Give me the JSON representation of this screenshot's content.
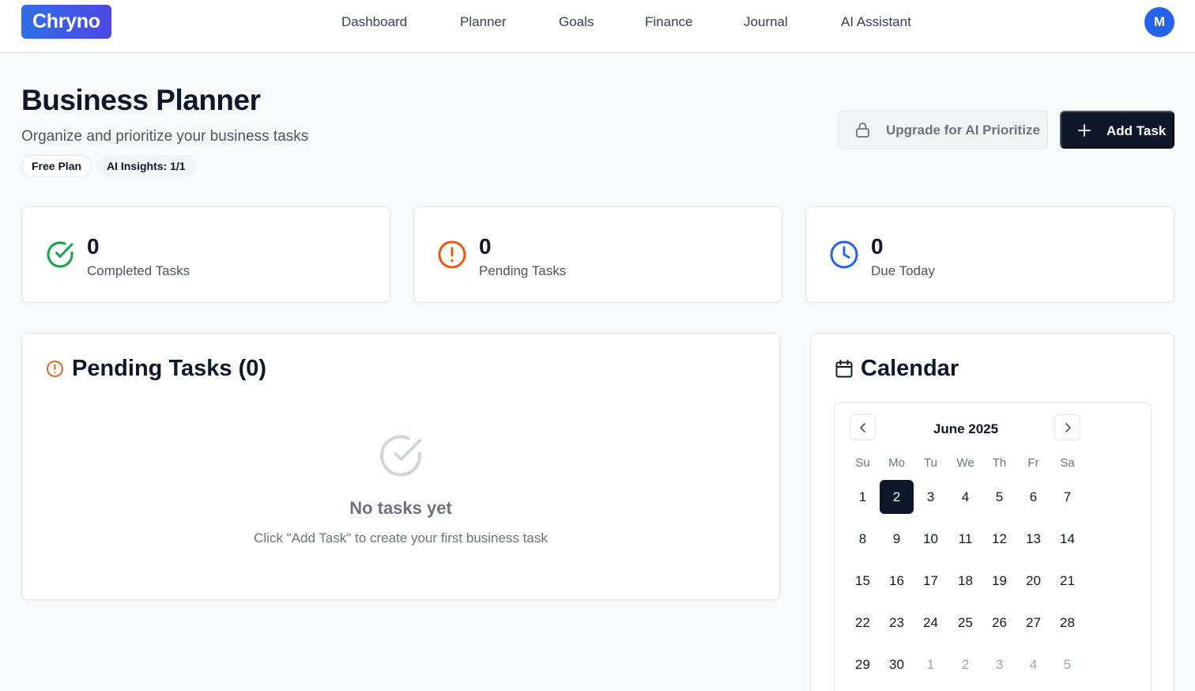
{
  "header": {
    "logo": "Chryno",
    "nav": [
      "Dashboard",
      "Planner",
      "Goals",
      "Finance",
      "Journal",
      "AI Assistant"
    ],
    "avatar_initial": "M"
  },
  "page": {
    "title": "Business Planner",
    "subtitle": "Organize and prioritize your business tasks",
    "badges": [
      "Free Plan",
      "AI Insights: 1/1"
    ],
    "upgrade_button": "Upgrade for AI Prioritize",
    "add_button": "Add Task"
  },
  "stats": [
    {
      "value": "0",
      "label": "Completed Tasks",
      "icon": "check-circle-icon",
      "color": "#16a34a"
    },
    {
      "value": "0",
      "label": "Pending Tasks",
      "icon": "alert-circle-icon",
      "color": "#ea580c"
    },
    {
      "value": "0",
      "label": "Due Today",
      "icon": "clock-icon",
      "color": "#2563eb"
    }
  ],
  "pending": {
    "title": "Pending Tasks (0)",
    "empty_title": "No tasks yet",
    "empty_subtitle": "Click \"Add Task\" to create your first business task"
  },
  "calendar": {
    "title": "Calendar",
    "month": "June 2025",
    "weekdays": [
      "Su",
      "Mo",
      "Tu",
      "We",
      "Th",
      "Fr",
      "Sa"
    ],
    "selected_day": "2",
    "weeks": [
      [
        "1",
        "2",
        "3",
        "4",
        "5",
        "6",
        "7"
      ],
      [
        "8",
        "9",
        "10",
        "11",
        "12",
        "13",
        "14"
      ],
      [
        "15",
        "16",
        "17",
        "18",
        "19",
        "20",
        "21"
      ],
      [
        "22",
        "23",
        "24",
        "25",
        "26",
        "27",
        "28"
      ],
      [
        "29",
        "30",
        "1",
        "2",
        "3",
        "4",
        "5"
      ]
    ],
    "outside_month_last_row_from": 2
  },
  "colors": {
    "accent": "#2563eb",
    "dark": "#0f172a",
    "success": "#16a34a",
    "warning": "#ea580c"
  }
}
